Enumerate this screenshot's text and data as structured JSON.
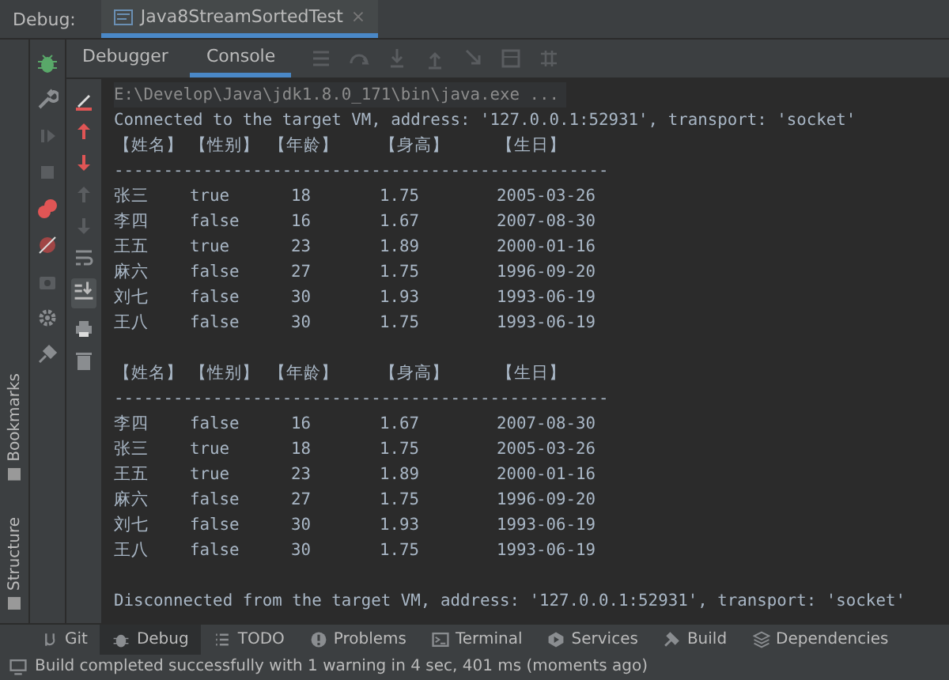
{
  "debug_bar": {
    "label": "Debug:",
    "tabs": [
      {
        "label": "Java8StreamSortedTest",
        "selected": true,
        "close": "×"
      }
    ]
  },
  "subtabs": [
    {
      "label": "Debugger",
      "selected": false
    },
    {
      "label": "Console",
      "selected": true
    }
  ],
  "side_panels": [
    {
      "label": "Bookmarks"
    },
    {
      "label": "Structure"
    }
  ],
  "console": {
    "command": "E:\\Develop\\Java\\jdk1.8.0_171\\bin\\java.exe ...",
    "connected": "Connected to the target VM, address: '127.0.0.1:52931', transport: 'socket'",
    "tables": [
      {
        "header": [
          "【姓名】",
          "【性别】",
          "【年龄】",
          "【身高】",
          "【生日】"
        ],
        "divider": "--------------------------------------------------",
        "rows": [
          [
            "张三",
            "true",
            "18",
            "1.75",
            "2005-03-26"
          ],
          [
            "李四",
            "false",
            "16",
            "1.67",
            "2007-08-30"
          ],
          [
            "王五",
            "true",
            "23",
            "1.89",
            "2000-01-16"
          ],
          [
            "麻六",
            "false",
            "27",
            "1.75",
            "1996-09-20"
          ],
          [
            "刘七",
            "false",
            "30",
            "1.93",
            "1993-06-19"
          ],
          [
            "王八",
            "false",
            "30",
            "1.75",
            "1993-06-19"
          ]
        ]
      },
      {
        "header": [
          "【姓名】",
          "【性别】",
          "【年龄】",
          "【身高】",
          "【生日】"
        ],
        "divider": "--------------------------------------------------",
        "rows": [
          [
            "李四",
            "false",
            "16",
            "1.67",
            "2007-08-30"
          ],
          [
            "张三",
            "true",
            "18",
            "1.75",
            "2005-03-26"
          ],
          [
            "王五",
            "true",
            "23",
            "1.89",
            "2000-01-16"
          ],
          [
            "麻六",
            "false",
            "27",
            "1.75",
            "1996-09-20"
          ],
          [
            "刘七",
            "false",
            "30",
            "1.93",
            "1993-06-19"
          ],
          [
            "王八",
            "false",
            "30",
            "1.75",
            "1993-06-19"
          ]
        ]
      }
    ],
    "disconnected": "Disconnected from the target VM, address: '127.0.0.1:52931', transport: 'socket'"
  },
  "tool_windows": [
    {
      "label": "Git",
      "selected": false
    },
    {
      "label": "Debug",
      "selected": true
    },
    {
      "label": "TODO",
      "selected": false
    },
    {
      "label": "Problems",
      "selected": false
    },
    {
      "label": "Terminal",
      "selected": false
    },
    {
      "label": "Services",
      "selected": false
    },
    {
      "label": "Build",
      "selected": false
    },
    {
      "label": "Dependencies",
      "selected": false
    }
  ],
  "status_bar": "Build completed successfully with 1 warning in 4 sec, 401 ms (moments ago)"
}
